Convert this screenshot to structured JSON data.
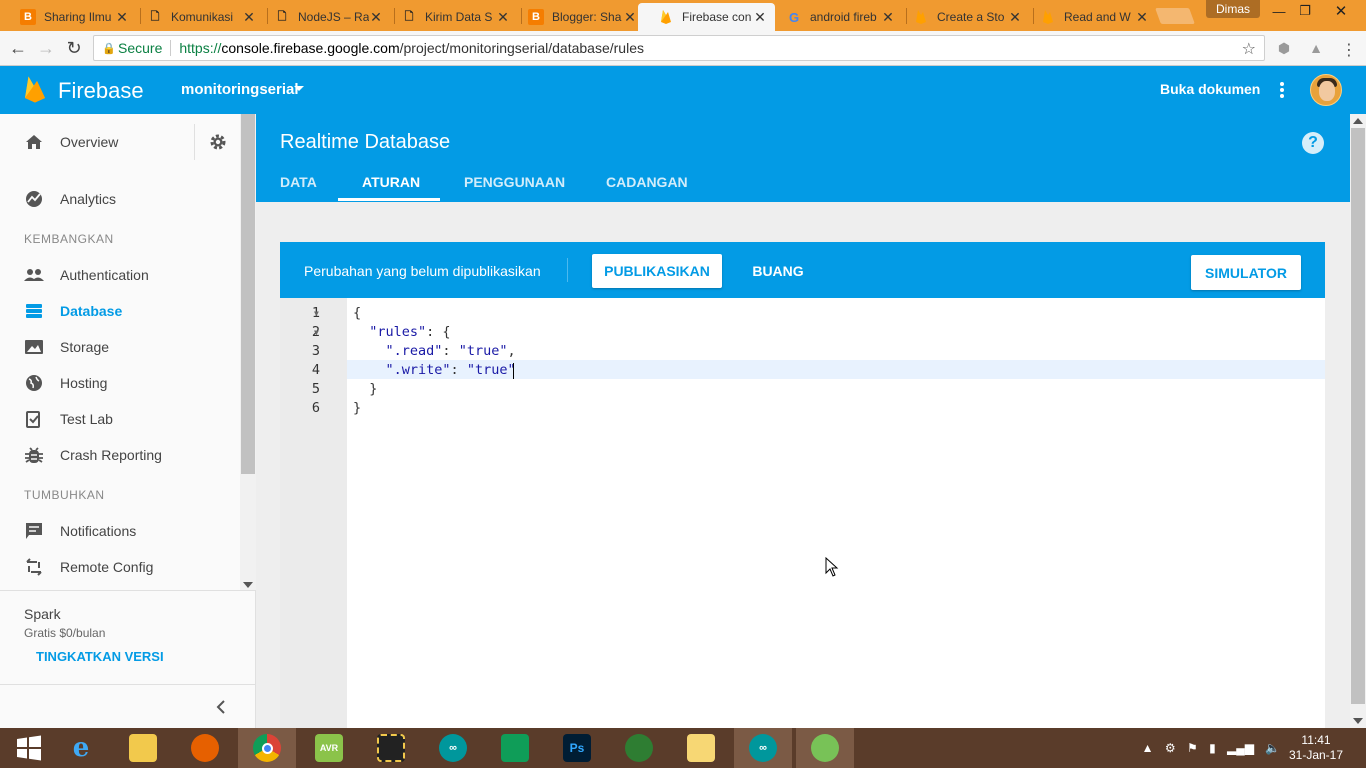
{
  "browser": {
    "tabs": [
      {
        "title": "Sharing Ilmu",
        "icon": "blogger-icon"
      },
      {
        "title": "Komunikasi",
        "icon": "document-icon"
      },
      {
        "title": "NodeJS – Ra",
        "icon": "document-icon"
      },
      {
        "title": "Kirim Data S",
        "icon": "document-icon"
      },
      {
        "title": "Blogger: Sha",
        "icon": "blogger-icon"
      },
      {
        "title": "Firebase con",
        "icon": "firebase-icon"
      },
      {
        "title": "android fireb",
        "icon": "google-icon"
      },
      {
        "title": "Create a Sto",
        "icon": "firebase-icon"
      },
      {
        "title": "Read and W",
        "icon": "firebase-icon"
      }
    ],
    "active_tab_index": 5,
    "profile_name": "Dimas",
    "secure_label": "Secure",
    "url_prefix": "https://",
    "url_host": "console.firebase.google.com",
    "url_path": "/project/monitoringserial/database/rules"
  },
  "header": {
    "product": "Firebase",
    "project": "monitoringserial",
    "docs_link": "Buka dokumen"
  },
  "sidebar": {
    "overview": "Overview",
    "analytics": "Analytics",
    "section_develop": "KEMBANGKAN",
    "develop_items": [
      {
        "label": "Authentication",
        "icon": "people-icon"
      },
      {
        "label": "Database",
        "icon": "database-icon",
        "active": true
      },
      {
        "label": "Storage",
        "icon": "photo-icon"
      },
      {
        "label": "Hosting",
        "icon": "globe-icon"
      },
      {
        "label": "Test Lab",
        "icon": "checklist-icon"
      },
      {
        "label": "Crash Reporting",
        "icon": "bug-icon"
      }
    ],
    "section_grow": "TUMBUHKAN",
    "grow_items": [
      {
        "label": "Notifications",
        "icon": "chat-icon"
      },
      {
        "label": "Remote Config",
        "icon": "config-icon"
      }
    ],
    "plan_name": "Spark",
    "plan_price": "Gratis $0/bulan",
    "upgrade": "TINGKATKAN VERSI"
  },
  "main": {
    "title": "Realtime Database",
    "tabs": [
      "DATA",
      "ATURAN",
      "PENGGUNAAN",
      "CADANGAN"
    ],
    "active_tab": "ATURAN",
    "unsaved_text": "Perubahan yang belum dipublikasikan",
    "publish_button": "PUBLIKASIKAN",
    "discard_button": "BUANG",
    "simulator_button": "SIMULATOR"
  },
  "editor": {
    "lines": [
      {
        "num": "1",
        "text": "{"
      },
      {
        "num": "2",
        "text": "  \"rules\": {"
      },
      {
        "num": "3",
        "text": "    \".read\": \"true\","
      },
      {
        "num": "4",
        "text": "    \".write\": \"true\""
      },
      {
        "num": "5",
        "text": "  }"
      },
      {
        "num": "6",
        "text": "}"
      }
    ],
    "active_line": 4
  },
  "taskbar": {
    "apps": [
      "start",
      "ie",
      "explorer",
      "firefox",
      "chrome",
      "avr-studio",
      "bascom",
      "arduino",
      "store",
      "photoshop",
      "idm",
      "folder",
      "arduino",
      "android-studio"
    ],
    "time": "11:41",
    "date": "31-Jan-17"
  },
  "colors": {
    "firebase_blue": "#039be5",
    "tab_strip": "#f09a30",
    "taskbar": "#5a3c2a"
  }
}
